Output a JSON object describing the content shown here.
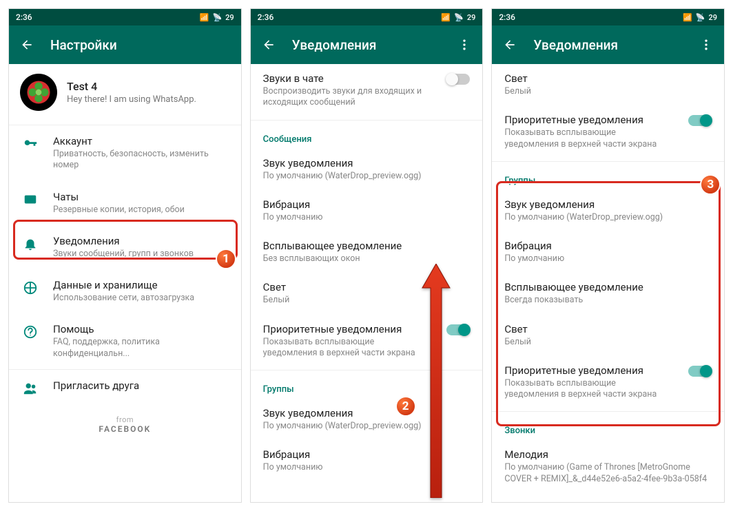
{
  "status": {
    "time": "2:36",
    "battery": "29"
  },
  "screen1": {
    "title": "Настройки",
    "profile": {
      "name": "Test 4",
      "status": "Hey there! I am using WhatsApp."
    },
    "items": [
      {
        "title": "Аккаунт",
        "sub": "Приватность, безопасность, изменить номер"
      },
      {
        "title": "Чаты",
        "sub": "Резервные копии, история, обои"
      },
      {
        "title": "Уведомления",
        "sub": "Звуки сообщений, групп и звонков"
      },
      {
        "title": "Данные и хранилище",
        "sub": "Использование сети, автозагрузка"
      },
      {
        "title": "Помощь",
        "sub": "FAQ, поддержка, политика конфиденциальн..."
      },
      {
        "title": "Пригласить друга",
        "sub": ""
      }
    ],
    "footer_from": "from",
    "footer_brand": "FACEBOOK"
  },
  "screen2": {
    "title": "Уведомления",
    "chatSounds": {
      "title": "Звуки в чате",
      "sub": "Воспроизводить звуки для входящих и исходящих сообщений"
    },
    "sect_messages": "Сообщения",
    "rows": [
      {
        "title": "Звук уведомления",
        "sub": "По умолчанию (WaterDrop_preview.ogg)"
      },
      {
        "title": "Вибрация",
        "sub": "По умолчанию"
      },
      {
        "title": "Всплывающее уведомление",
        "sub": "Без всплывающих окон"
      },
      {
        "title": "Свет",
        "sub": "Белый"
      },
      {
        "title": "Приоритетные уведомления",
        "sub": "Показывать всплывающие уведомления в верхней части экрана"
      }
    ],
    "sect_groups": "Группы",
    "grows": [
      {
        "title": "Звук уведомления",
        "sub": "По умолчанию (WaterDrop_preview.ogg)"
      },
      {
        "title": "Вибрация",
        "sub": "По умолчанию"
      }
    ]
  },
  "screen3": {
    "title": "Уведомления",
    "top": [
      {
        "title": "Свет",
        "sub": "Белый"
      },
      {
        "title": "Приоритетные уведомления",
        "sub": "Показывать всплывающие уведомления в верхней части экрана"
      }
    ],
    "sect_groups": "Группы",
    "group_rows": [
      {
        "title": "Звук уведомления",
        "sub": "По умолчанию (WaterDrop_preview.ogg)"
      },
      {
        "title": "Вибрация",
        "sub": "По умолчанию"
      },
      {
        "title": "Всплывающее уведомление",
        "sub": "Всегда показывать"
      },
      {
        "title": "Свет",
        "sub": "Белый"
      },
      {
        "title": "Приоритетные уведомления",
        "sub": "Показывать всплывающие уведомления в верхней части экрана"
      }
    ],
    "sect_calls": "Звонки",
    "call_rows": [
      {
        "title": "Мелодия",
        "sub": "По умолчанию (Game of Thrones [MetroGnome COVER + REMIX]_&_d44e52e6-a5a2-4fee-9b3a-058f4"
      }
    ]
  }
}
